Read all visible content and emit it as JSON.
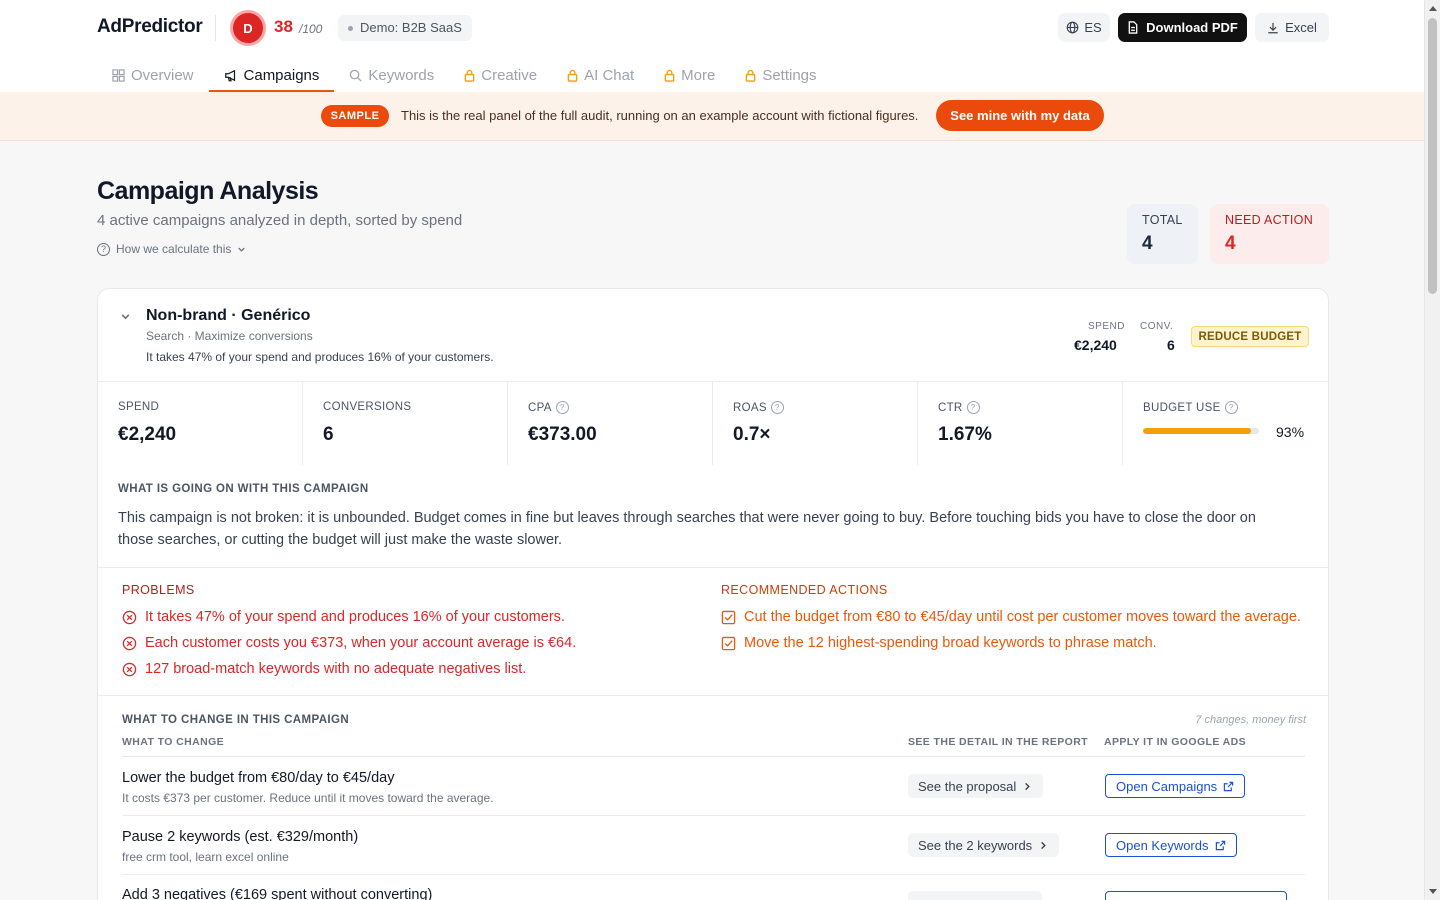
{
  "header": {
    "brand": "AdPredictor",
    "score_initial": "D",
    "score": "38",
    "score_max": "/100",
    "demo_label": "Demo: B2B SaaS",
    "lang_label": "ES",
    "download_pdf": "Download PDF",
    "excel": "Excel"
  },
  "tabs": [
    {
      "label": "Overview",
      "icon": "grid-icon",
      "locked": false,
      "active": false
    },
    {
      "label": "Campaigns",
      "icon": "megaphone-icon",
      "locked": false,
      "active": true
    },
    {
      "label": "Keywords",
      "icon": "search-icon",
      "locked": false,
      "active": false
    },
    {
      "label": "Creative",
      "icon": "lock-icon",
      "locked": true,
      "active": false
    },
    {
      "label": "AI Chat",
      "icon": "lock-icon",
      "locked": true,
      "active": false
    },
    {
      "label": "More",
      "icon": "lock-icon",
      "locked": true,
      "active": false
    },
    {
      "label": "Settings",
      "icon": "lock-icon",
      "locked": true,
      "active": false
    }
  ],
  "banner": {
    "tag": "SAMPLE",
    "text": "This is the real panel of the full audit, running on an example account with fictional figures.",
    "cta": "See mine with my data"
  },
  "page": {
    "title": "Campaign Analysis",
    "subtitle": "4 active campaigns analyzed in depth, sorted by spend",
    "how_calc": "How we calculate this"
  },
  "stats": {
    "total_label": "TOTAL",
    "total_value": "4",
    "need_label": "NEED ACTION",
    "need_value": "4"
  },
  "campaign": {
    "name": "Non-brand · Genérico",
    "type": "Search · Maximize conversions",
    "desc": "It takes 47% of your spend and produces 16% of your customers.",
    "spend_label": "SPEND",
    "spend_value": "€2,240",
    "conv_label": "CONV.",
    "conv_value": "6",
    "badge": "REDUCE BUDGET",
    "metrics": {
      "spend": {
        "label": "SPEND",
        "value": "€2,240"
      },
      "conversions": {
        "label": "CONVERSIONS",
        "value": "6"
      },
      "cpa": {
        "label": "CPA",
        "value": "€373.00"
      },
      "roas": {
        "label": "ROAS",
        "value": "0.7×"
      },
      "ctr": {
        "label": "CTR",
        "value": "1.67%"
      },
      "budget_use": {
        "label": "BUDGET USE",
        "value": "93%",
        "fraction": 0.93
      }
    },
    "going_on_heading": "WHAT IS GOING ON WITH THIS CAMPAIGN",
    "going_on_text": "This campaign is not broken: it is unbounded. Budget comes in fine but leaves through searches that were never going to buy. Before touching bids you have to close the door on those searches, or cutting the budget will just make the waste slower.",
    "problems_heading": "PROBLEMS",
    "problems": [
      "It takes 47% of your spend and produces 16% of your customers.",
      "Each customer costs you €373, when your account average is €64.",
      "127 broad-match keywords with no adequate negatives list."
    ],
    "actions_heading": "RECOMMENDED ACTIONS",
    "actions": [
      "Cut the budget from €80 to €45/day until cost per customer moves toward the average.",
      "Move the 12 highest-spending broad keywords to phrase match."
    ],
    "changes": {
      "heading": "WHAT TO CHANGE IN THIS CAMPAIGN",
      "meta": "7 changes, money first",
      "col_what": "WHAT TO CHANGE",
      "col_detail": "SEE THE DETAIL IN THE REPORT",
      "col_apply": "APPLY IT IN GOOGLE ADS",
      "rows": [
        {
          "title": "Lower the budget from €80/day to €45/day",
          "sub": "It costs €373 per customer. Reduce until it moves toward the average.",
          "see": "See the proposal",
          "open": "Open Campaigns"
        },
        {
          "title": "Pause 2 keywords (est. €329/month)",
          "sub": "free crm tool, learn excel online",
          "see": "See the 2 keywords",
          "open": "Open Keywords"
        },
        {
          "title": "Add 3 negatives (€169 spent without converting)",
          "sub": "",
          "see": "",
          "open": ""
        }
      ]
    }
  },
  "colors": {
    "accent": "#ea4a0c",
    "danger": "#dc2626",
    "warning": "#f59e0b",
    "link": "#1d4ed8"
  }
}
